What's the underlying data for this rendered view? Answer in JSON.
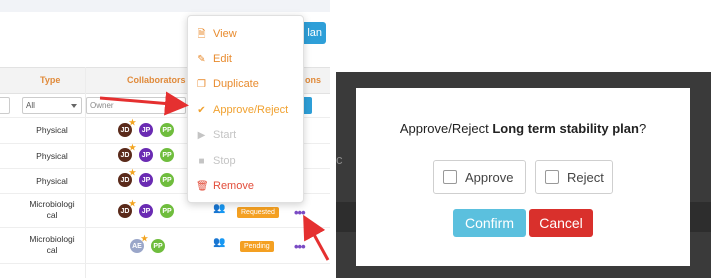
{
  "table": {
    "plan_button": "lan",
    "columns": {
      "type": "Type",
      "collaborators": "Collaborators",
      "actions": "ons"
    },
    "filters": {
      "type_select": "All",
      "owner_placeholder": "Owner"
    },
    "rows": [
      {
        "type_line1": "Physical",
        "type_line2": "",
        "avatars": [
          "JD",
          "JP",
          "PP"
        ],
        "status": "",
        "dots": ""
      },
      {
        "type_line1": "Physical",
        "type_line2": "",
        "avatars": [
          "JD",
          "JP",
          "PP"
        ],
        "status": "",
        "dots": ""
      },
      {
        "type_line1": "Physical",
        "type_line2": "",
        "avatars": [
          "JD",
          "JP",
          "PP"
        ],
        "status": "",
        "dots": ""
      },
      {
        "type_line1": "Microbiologi",
        "type_line2": "cal",
        "avatars": [
          "JD",
          "JP",
          "PP"
        ],
        "status": "Requested",
        "dots": "•••"
      },
      {
        "type_line1": "Microbiologi",
        "type_line2": "cal",
        "avatars": [
          "AE",
          "PP"
        ],
        "status": "Pending",
        "dots": "•••"
      }
    ]
  },
  "menu": {
    "items": [
      {
        "label": "View",
        "icon": "document-icon"
      },
      {
        "label": "Edit",
        "icon": "edit-icon"
      },
      {
        "label": "Duplicate",
        "icon": "copy-icon"
      },
      {
        "label": "Approve/Reject",
        "icon": "check-circle-icon"
      },
      {
        "label": "Start",
        "icon": "play-icon"
      },
      {
        "label": "Stop",
        "icon": "stop-icon"
      },
      {
        "label": "Remove",
        "icon": "trash-icon"
      }
    ]
  },
  "modal": {
    "question_prefix": "Approve/Reject ",
    "plan_name": "Long term stability plan",
    "question_suffix": "?",
    "approve_label": "Approve",
    "reject_label": "Reject",
    "confirm_label": "Confirm",
    "cancel_label": "Cancel"
  },
  "colors": {
    "accent_orange": "#e88b2e",
    "confirm_blue": "#5bc0de",
    "cancel_red": "#d9302c",
    "arrow_red": "#e53030"
  }
}
